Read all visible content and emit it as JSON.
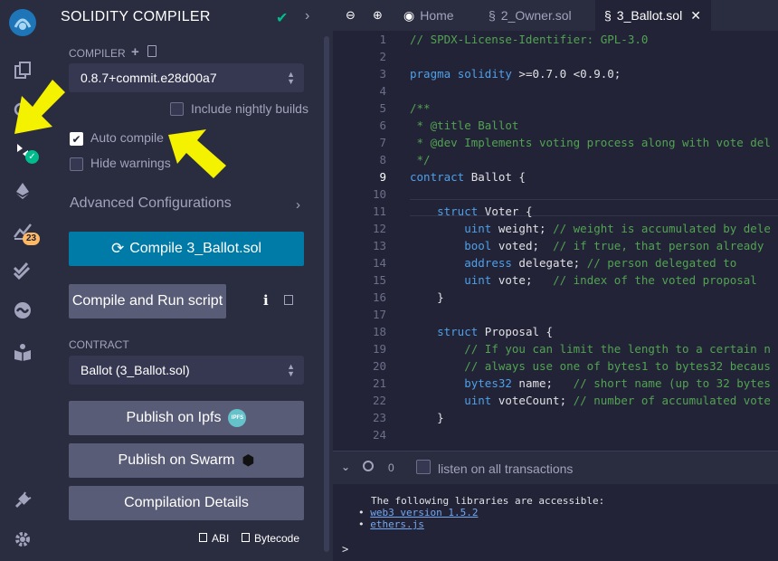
{
  "rail": {
    "badge": "23",
    "icons": [
      "remix-logo-icon",
      "file-explorer-icon",
      "search-icon",
      "solidity-compiler-icon",
      "deploy-run-icon",
      "analysis-icon",
      "unit-testing-icon",
      "debugger-icon",
      "learneth-icon",
      "plugin-manager-icon",
      "settings-icon"
    ]
  },
  "panel": {
    "title": "SOLIDITY COMPILER",
    "compiler_label": "COMPILER",
    "compiler_version": "0.8.7+commit.e28d00a7",
    "nightly_label": "Include nightly builds",
    "nightly_checked": false,
    "autocompile_label": "Auto compile",
    "autocompile_checked": true,
    "hidewarnings_label": "Hide warnings",
    "hidewarnings_checked": false,
    "advanced_label": "Advanced Configurations",
    "compile_button": "Compile 3_Ballot.sol",
    "compile_run_button": "Compile and Run script",
    "contract_label": "CONTRACT",
    "contract_selected": "Ballot (3_Ballot.sol)",
    "publish_ipfs": "Publish on Ipfs",
    "ipfs_badge": "IPFS",
    "publish_swarm": "Publish on Swarm",
    "compilation_details": "Compilation Details",
    "abi_label": "ABI",
    "bytecode_label": "Bytecode"
  },
  "editor": {
    "tabs": [
      {
        "label": "Home",
        "active": false
      },
      {
        "label": "2_Owner.sol",
        "active": false
      },
      {
        "label": "3_Ballot.sol",
        "active": true
      }
    ],
    "current_line": 9,
    "lines": [
      {
        "n": "1",
        "text": "// SPDX-License-Identifier: GPL-3.0"
      },
      {
        "n": "2",
        "text": ""
      },
      {
        "n": "3",
        "text": "pragma solidity >=0.7.0 <0.9.0;"
      },
      {
        "n": "4",
        "text": ""
      },
      {
        "n": "5",
        "text": "/**"
      },
      {
        "n": "6",
        "text": " * @title Ballot"
      },
      {
        "n": "7",
        "text": " * @dev Implements voting process along with vote del"
      },
      {
        "n": "8",
        "text": " */"
      },
      {
        "n": "9",
        "text": "contract Ballot {"
      },
      {
        "n": "10",
        "text": ""
      },
      {
        "n": "11",
        "text": "    struct Voter {"
      },
      {
        "n": "12",
        "text": "        uint weight; // weight is accumulated by dele"
      },
      {
        "n": "13",
        "text": "        bool voted;  // if true, that person already"
      },
      {
        "n": "14",
        "text": "        address delegate; // person delegated to"
      },
      {
        "n": "15",
        "text": "        uint vote;   // index of the voted proposal"
      },
      {
        "n": "16",
        "text": "    }"
      },
      {
        "n": "17",
        "text": ""
      },
      {
        "n": "18",
        "text": "    struct Proposal {"
      },
      {
        "n": "19",
        "text": "        // If you can limit the length to a certain n"
      },
      {
        "n": "20",
        "text": "        // always use one of bytes1 to bytes32 becaus"
      },
      {
        "n": "21",
        "text": "        bytes32 name;   // short name (up to 32 bytes"
      },
      {
        "n": "22",
        "text": "        uint voteCount; // number of accumulated vote"
      },
      {
        "n": "23",
        "text": "    }"
      },
      {
        "n": "24",
        "text": ""
      }
    ]
  },
  "terminal": {
    "counter": "0",
    "listen_label": "listen on all transactions",
    "message": "The following libraries are accessible:",
    "libs": [
      "web3 version 1.5.2",
      "ethers.js"
    ],
    "prompt": ">"
  },
  "colors": {
    "accent": "#007aa6",
    "success": "#00bc8c",
    "badge": "#ffb964",
    "callout": "#f5f200"
  }
}
